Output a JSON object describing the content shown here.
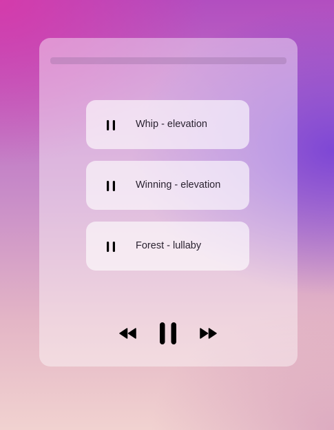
{
  "player": {
    "progress": 0.0,
    "is_playing": true,
    "tracks": [
      {
        "label": "Whip - elevation",
        "icon": "pause-icon"
      },
      {
        "label": "Winning - elevation",
        "icon": "pause-icon"
      },
      {
        "label": "Forest - lullaby",
        "icon": "pause-icon"
      }
    ],
    "controls": {
      "previous_icon": "rewind-icon",
      "play_pause_icon": "pause-icon",
      "next_icon": "fast-forward-icon"
    }
  }
}
